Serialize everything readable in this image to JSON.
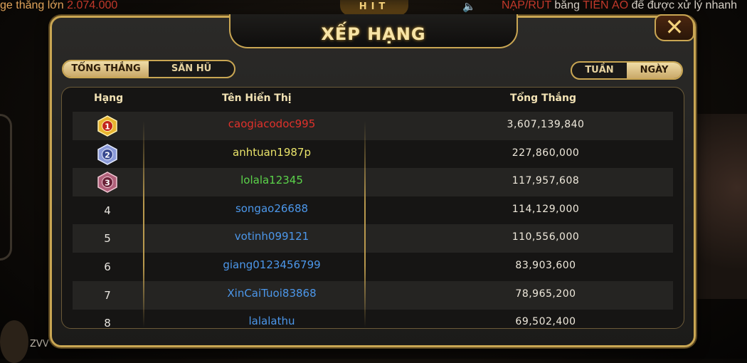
{
  "ticker": {
    "left_prefix": "ge ",
    "left_text": "thắng lớn ",
    "left_amount": "2.074.000",
    "right_text_1": "NẠP/RÚT ",
    "right_text_2": "bằng ",
    "right_text_3": "TIỀN ẢO",
    "right_text_4": " để được xử lý nhanh"
  },
  "dialog": {
    "title": "XẾP HẠNG",
    "close_label": "✕"
  },
  "category_toggle": {
    "options": [
      "TỔNG THẮNG",
      "SĂN HŨ"
    ],
    "selected": "TỔNG THẮNG"
  },
  "period_toggle": {
    "options": [
      "TUẦN",
      "NGÀY"
    ],
    "selected": "NGÀY"
  },
  "table": {
    "headers": {
      "rank": "Hạng",
      "name": "Tên Hiển Thị",
      "total": "Tổng Thắng"
    },
    "rows": [
      {
        "rank": "1",
        "name": "caogiacodoc995",
        "total": "3,607,139,840",
        "name_color": "#e0312b",
        "medal": "gold"
      },
      {
        "rank": "2",
        "name": "anhtuan1987p",
        "total": "227,860,000",
        "name_color": "#e9e36a",
        "medal": "silver"
      },
      {
        "rank": "3",
        "name": "lolala12345",
        "total": "117,957,608",
        "name_color": "#5bd34a",
        "medal": "bronze"
      },
      {
        "rank": "4",
        "name": "songao26688",
        "total": "114,129,000",
        "name_color": "#4c97ea"
      },
      {
        "rank": "5",
        "name": "votinh099121",
        "total": "110,556,000",
        "name_color": "#4c97ea"
      },
      {
        "rank": "6",
        "name": "giang0123456799",
        "total": "83,903,600",
        "name_color": "#4c97ea"
      },
      {
        "rank": "7",
        "name": "XinCaiTuoi83868",
        "total": "78,965,200",
        "name_color": "#4c97ea"
      },
      {
        "rank": "8",
        "name": "lalalathu",
        "total": "69,502,400",
        "name_color": "#4c97ea"
      }
    ]
  },
  "bottom_left_text": "ZVV",
  "colors": {
    "gold_border": "#c9a653",
    "title": "#f7e4a6"
  }
}
